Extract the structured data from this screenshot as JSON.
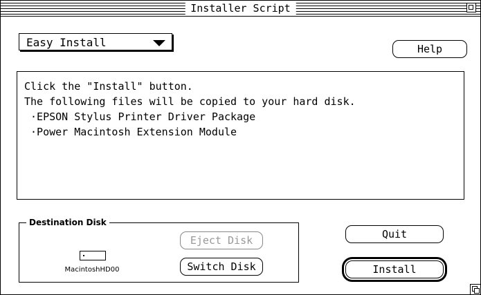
{
  "window": {
    "title": "Installer Script"
  },
  "install_mode": {
    "selected": "Easy Install"
  },
  "buttons": {
    "help": "Help",
    "eject_disk": "Eject Disk",
    "switch_disk": "Switch Disk",
    "quit": "Quit",
    "install": "Install"
  },
  "message": {
    "lines": [
      "Click the \"Install\" button.",
      "The following files will be copied to your hard disk.",
      " ·EPSON Stylus Printer Driver Package",
      " ·Power Macintosh Extension Module"
    ]
  },
  "destination": {
    "label": "Destination Disk",
    "disk_name": "MacintoshHD00"
  },
  "icons": {
    "zoom": "zoom-box-icon",
    "popup_arrow": "triangle-down-icon",
    "disk": "hard-disk-icon",
    "grow": "grow-box-icon"
  }
}
